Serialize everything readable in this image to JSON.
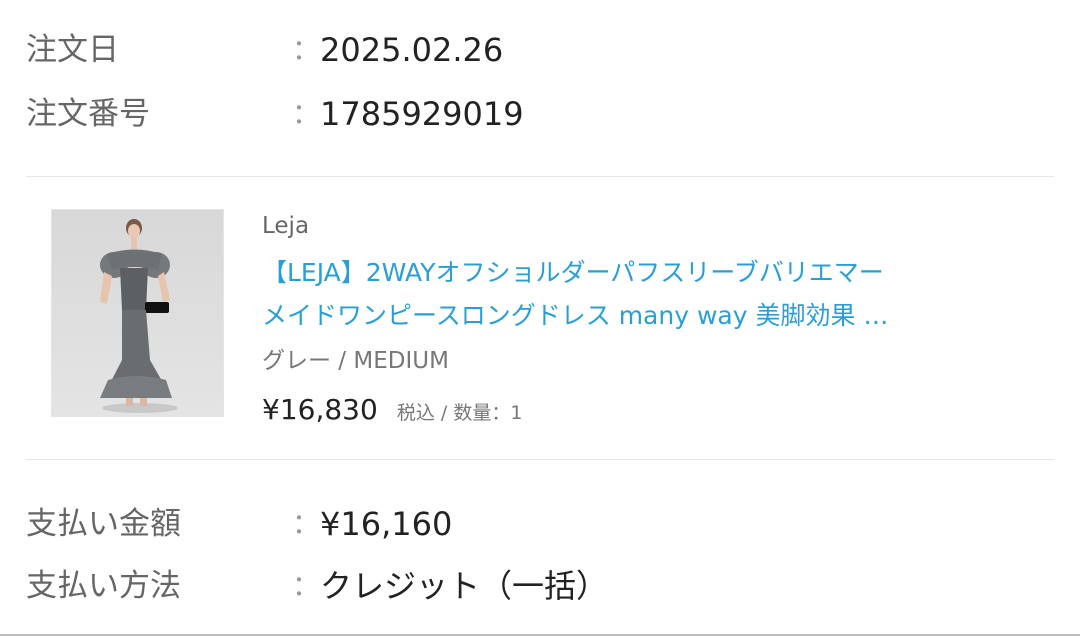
{
  "order": {
    "date_label": "注文日",
    "date_value": "2025.02.26",
    "number_label": "注文番号",
    "number_value": "1785929019",
    "colon": "："
  },
  "product": {
    "image_icon": "dress-photo",
    "brand": "Leja",
    "title_line1": "【LEJA】2WAYオフショルダーパフスリーブバリエマー",
    "title_line2": "メイドワンピースロングドレス many way 美脚効果 …",
    "variant": "グレー / MEDIUM",
    "price": "¥16,830",
    "price_meta": "税込 / 数量：1",
    "title_color": "#2a9fd6"
  },
  "payment": {
    "amount_label": "支払い金額",
    "amount_value": "¥16,160",
    "method_label": "支払い方法",
    "method_value": "クレジット（一括）"
  }
}
